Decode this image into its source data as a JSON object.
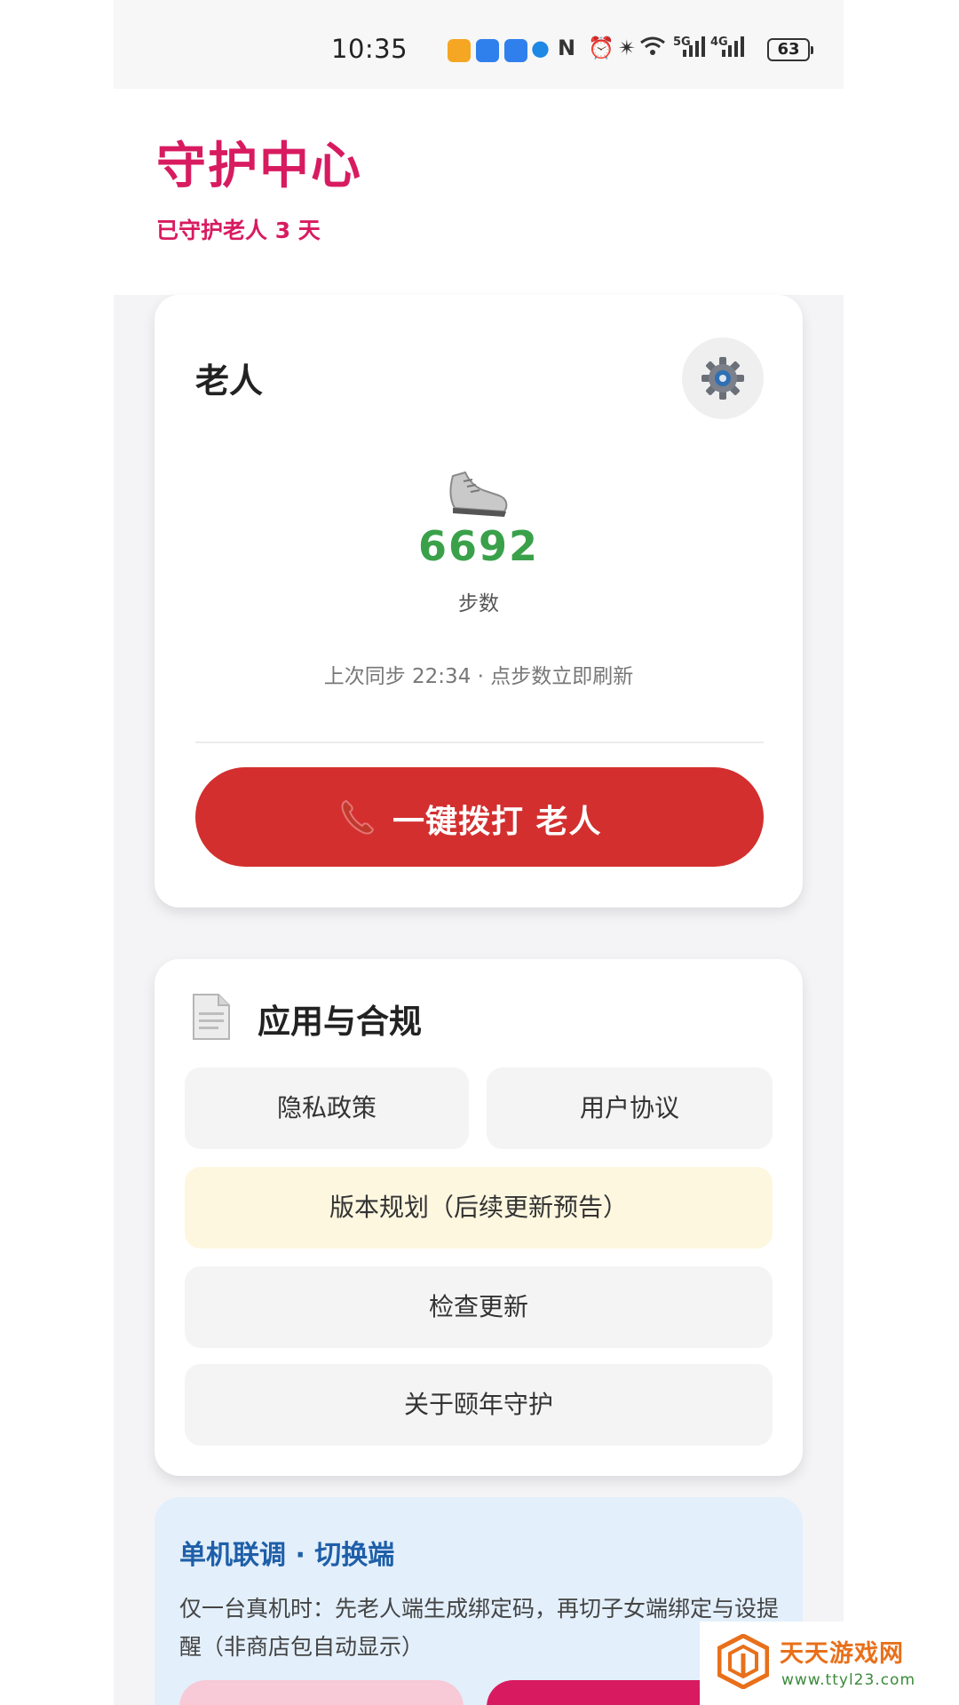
{
  "status_bar": {
    "time": "10:35",
    "network_5g": "5G",
    "network_4g": "4G",
    "battery": "63",
    "icons": [
      "app-notification-icon",
      "app-notification-icon",
      "bluetooth-icon",
      "shield-icon",
      "nfc-icon",
      "alarm-icon",
      "bluetooth-icon",
      "wifi-icon",
      "signal-icon",
      "signal-icon",
      "battery-icon"
    ]
  },
  "header": {
    "title": "守护中心",
    "subtitle": "已守护老人 3 天"
  },
  "elder_card": {
    "name": "老人",
    "settings_icon": "gear-icon",
    "step_icon": "sneaker-icon",
    "steps": "6692",
    "steps_label": "步数",
    "sync_info": "上次同步 22:34 · 点步数立即刷新",
    "call_icon": "phone-icon",
    "call_label": "一键拨打 老人"
  },
  "compliance_card": {
    "icon": "document-icon",
    "title": "应用与合规",
    "buttons": {
      "privacy": "隐私政策",
      "terms": "用户协议",
      "roadmap": "版本规划（后续更新预告）",
      "check_update": "检查更新",
      "about": "关于颐年守护"
    }
  },
  "debug_card": {
    "title": "单机联调 · 切换端",
    "description": "仅一台真机时：先老人端生成绑定码，再切子女端绑定与设提醒（非商店包自动显示）"
  },
  "watermark": {
    "name": "天天游戏网",
    "url": "www.ttyl23.com"
  },
  "colors": {
    "brand": "#d81b60",
    "call": "#d32f2f",
    "steps": "#3aa14a",
    "debug_title": "#1e5fa8",
    "debug_bg": "#e3effb",
    "roadmap_bg": "#fdf7e0"
  }
}
